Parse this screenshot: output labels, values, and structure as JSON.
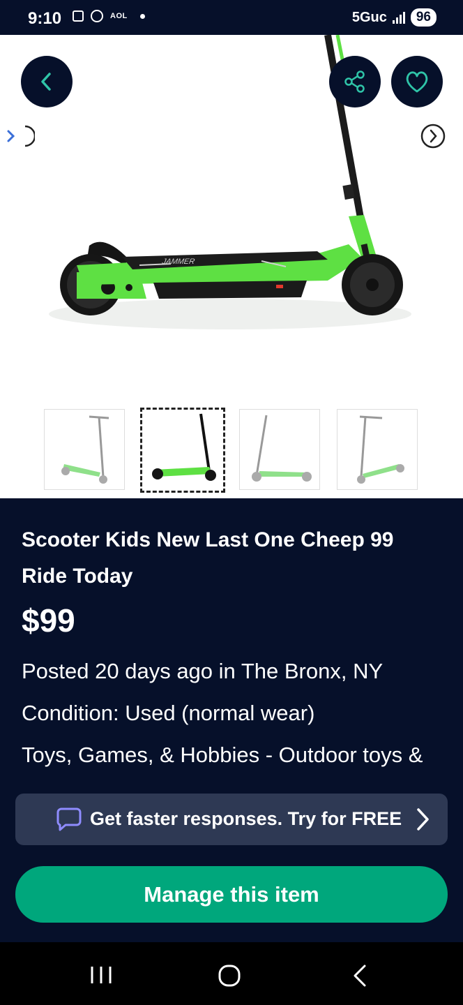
{
  "status_bar": {
    "time": "9:10",
    "aol_label": "AOL",
    "network": "5Guc",
    "battery": "96"
  },
  "listing": {
    "title": "Scooter Kids New Last One Cheep  99 Ride Today",
    "price": "$99",
    "posted": "Posted 20 days ago in The Bronx, NY",
    "condition": "Condition: Used (normal wear)",
    "category": "Toys, Games, & Hobbies - Outdoor toys &"
  },
  "product_image": {
    "brand_text": "JAMMER"
  },
  "promo": {
    "label": "Get faster responses. Try for FREE"
  },
  "actions": {
    "manage_label": "Manage this item"
  },
  "colors": {
    "background": "#06102a",
    "accent": "#00a77c",
    "icon_accent": "#2fc4a8",
    "promo_bg": "#2e3954",
    "chat_icon": "#8f8cff",
    "scooter_green": "#5ee043"
  }
}
